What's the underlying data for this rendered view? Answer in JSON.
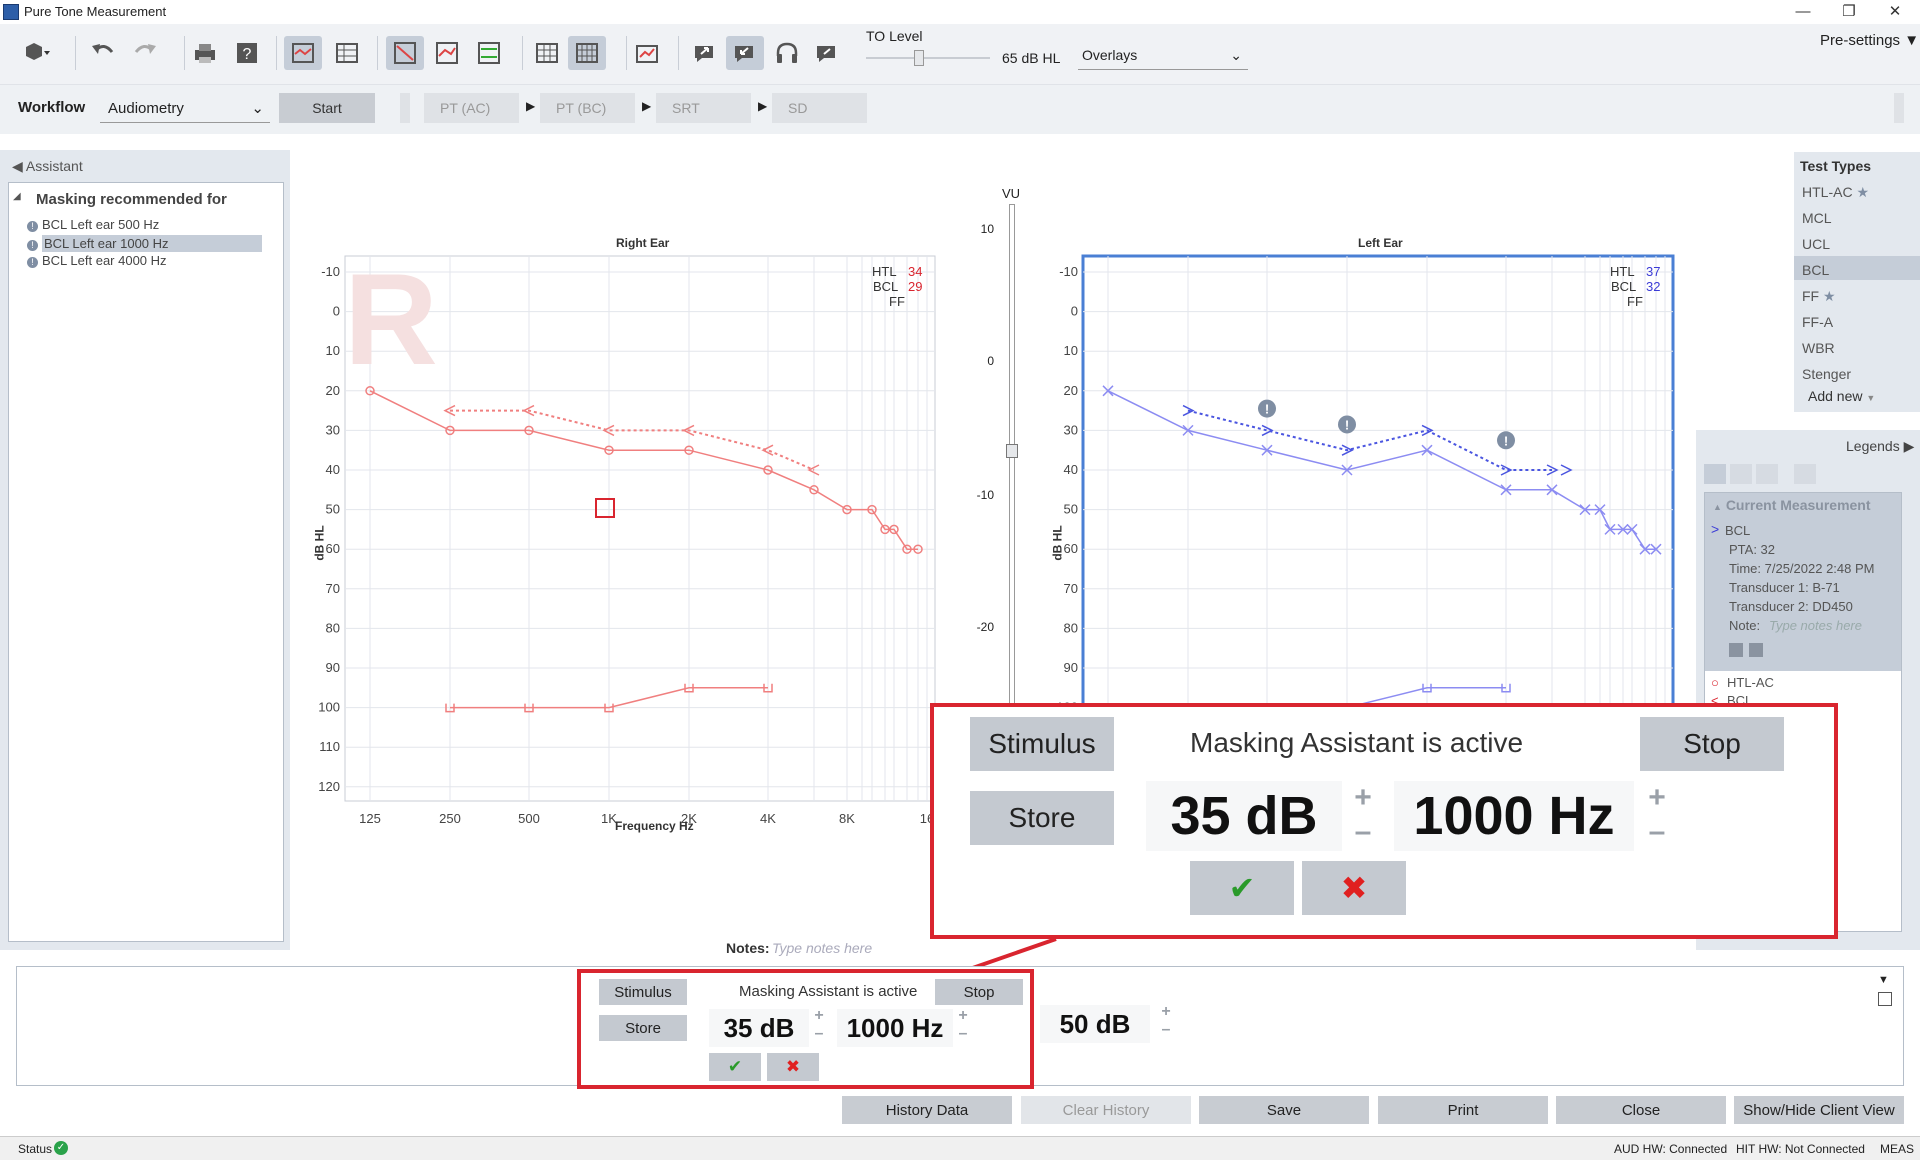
{
  "window": {
    "title": "Pure Tone Measurement"
  },
  "toolbar": {
    "to_level_label": "TO Level",
    "to_level_value": "65 dB HL",
    "overlays": "Overlays",
    "presettings": "Pre-settings"
  },
  "workflow": {
    "label": "Workflow",
    "selected": "Audiometry",
    "start": "Start",
    "steps": [
      "PT (AC)",
      "PT (BC)",
      "SRT",
      "SD"
    ]
  },
  "assistant": {
    "header": "Assistant",
    "group": "Masking recommended for",
    "items": [
      "BCL Left ear 500 Hz",
      "BCL Left ear 1000 Hz",
      "BCL Left ear 4000 Hz"
    ]
  },
  "right_ear": {
    "title": "Right Ear",
    "watermark": "R",
    "ylabel": "dB HL",
    "xlabel": "Frequency Hz",
    "htl_label": "HTL",
    "htl_value": "34",
    "bcl_label": "BCL",
    "bcl_value": "29",
    "ff_label": "FF"
  },
  "left_ear": {
    "title": "Left Ear",
    "ylabel": "dB HL",
    "htl_label": "HTL",
    "htl_value": "37",
    "bcl_label": "BCL",
    "bcl_value": "32",
    "ff_label": "FF"
  },
  "y_ticks": [
    "-10",
    "0",
    "10",
    "20",
    "30",
    "40",
    "50",
    "60",
    "70",
    "80",
    "90",
    "100",
    "110",
    "120"
  ],
  "x_ticks": [
    "125",
    "250",
    "500",
    "1K",
    "2K",
    "4K",
    "8K",
    "16"
  ],
  "vu": {
    "label": "VU",
    "ticks": [
      "10",
      "0",
      "-10",
      "-20"
    ]
  },
  "test_types": {
    "header": "Test Types",
    "items": [
      "HTL-AC",
      "MCL",
      "UCL",
      "BCL",
      "FF",
      "FF-A",
      "WBR",
      "Stenger"
    ],
    "add_new": "Add new"
  },
  "legends": {
    "header": "Legends",
    "current": "Current Measurement",
    "entry": {
      "name": "BCL",
      "pta": "PTA: 32",
      "time": "Time: 7/25/2022 2:48 PM",
      "t1": "Transducer 1: B-71",
      "t2": "Transducer 2: DD450",
      "note_label": "Note:",
      "note_placeholder": "Type notes here"
    },
    "others": [
      "HTL-AC",
      "BCL"
    ]
  },
  "masking": {
    "stimulus": "Stimulus",
    "status": "Masking Assistant is active",
    "stop": "Stop",
    "store": "Store",
    "level": "35 dB",
    "frequency": "1000 Hz",
    "masking_level": "50 dB"
  },
  "notes": {
    "label": "Notes:",
    "placeholder": "Type notes here"
  },
  "bottom_buttons": {
    "history": "History Data",
    "clear": "Clear History",
    "save": "Save",
    "print": "Print",
    "close": "Close",
    "client": "Show/Hide Client View"
  },
  "status": {
    "label": "Status",
    "aud": "AUD HW: Connected",
    "hit": "HIT HW: Not Connected",
    "meas": "MEAS"
  },
  "colors": {
    "right": "#f07f7f",
    "left": "#8c8cf2",
    "accent": "#d9252f",
    "selected": "#c5cdd8"
  },
  "chart_data": [
    {
      "type": "line",
      "title": "Right Ear",
      "xlabel": "Frequency Hz",
      "ylabel": "dB HL",
      "ylim": [
        -10,
        120
      ],
      "y_inverted": true,
      "x": [
        "125",
        "250",
        "500",
        "1K",
        "2K",
        "4K",
        "6K",
        "8K",
        "10K",
        "11K",
        "12K",
        "14K",
        "16K"
      ],
      "series": [
        {
          "name": "HTL",
          "values": [
            20,
            30,
            30,
            35,
            35,
            40,
            45,
            50,
            50,
            55,
            55,
            60,
            60
          ]
        },
        {
          "name": "BCL",
          "x": [
            "250",
            "500",
            "1K",
            "2K",
            "4K",
            "6K"
          ],
          "values": [
            25,
            25,
            30,
            30,
            35,
            40
          ]
        },
        {
          "name": "UCL",
          "x": [
            "250",
            "500",
            "1K",
            "2K",
            "4K"
          ],
          "values": [
            100,
            100,
            100,
            95,
            95
          ]
        }
      ]
    },
    {
      "type": "line",
      "title": "Left Ear",
      "xlabel": "Frequency Hz",
      "ylabel": "dB HL",
      "ylim": [
        -10,
        120
      ],
      "y_inverted": true,
      "x": [
        "125",
        "250",
        "500",
        "1K",
        "2K",
        "4K",
        "6K",
        "8K",
        "9K",
        "10K",
        "11K",
        "12K",
        "14K",
        "16K"
      ],
      "series": [
        {
          "name": "HTL",
          "values": [
            20,
            30,
            35,
            40,
            35,
            45,
            45,
            50,
            50,
            55,
            55,
            55,
            60,
            60
          ]
        },
        {
          "name": "BCL",
          "x": [
            "250",
            "500",
            "1K",
            "2K",
            "4K",
            "6K"
          ],
          "values": [
            25,
            30,
            35,
            30,
            40,
            40
          ]
        }
      ]
    }
  ]
}
